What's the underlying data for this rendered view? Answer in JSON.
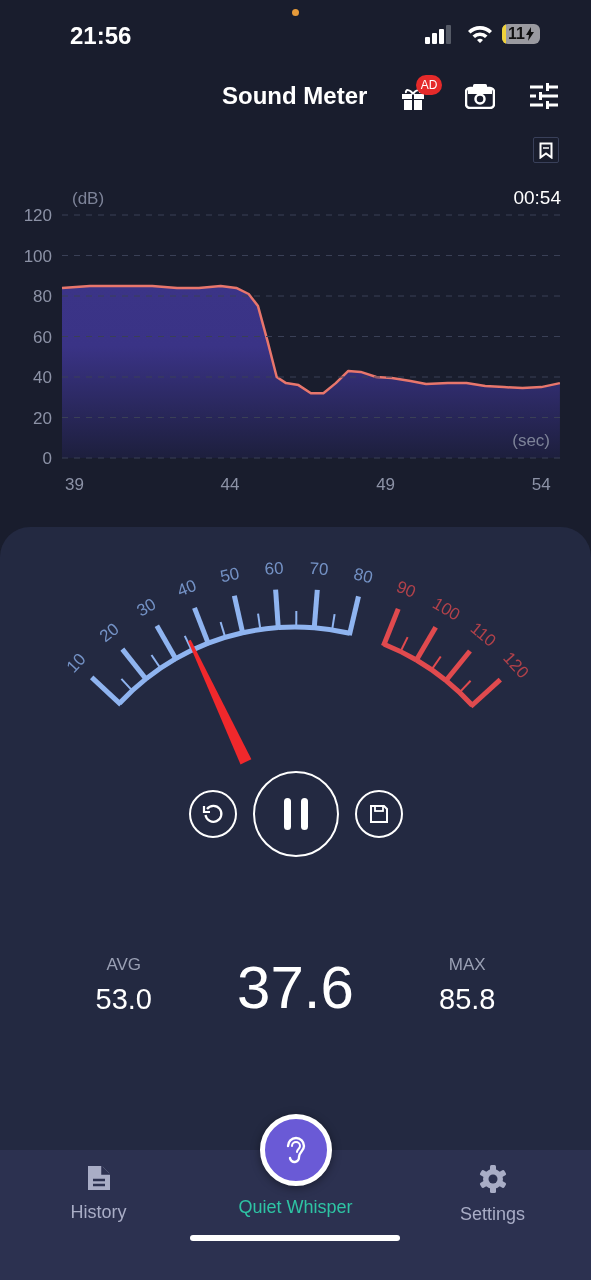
{
  "status_bar": {
    "time": "21:56",
    "battery": "11"
  },
  "header": {
    "title": "Sound Meter",
    "badge": "AD"
  },
  "chart": {
    "elapsed": "00:54",
    "chart_data": {
      "type": "area",
      "ylabel": "(dB)",
      "xlabel": "(sec)",
      "xlim": [
        38.6,
        54.7
      ],
      "ylim": [
        0,
        120
      ],
      "xticks": [
        39,
        44,
        49,
        54
      ],
      "yticks": [
        0,
        20,
        40,
        60,
        80,
        100,
        120
      ],
      "x": [
        38.6,
        39.5,
        40.5,
        41.5,
        42.3,
        43,
        43.7,
        44.2,
        44.6,
        44.9,
        45.2,
        45.5,
        45.8,
        46.2,
        46.6,
        47,
        47.4,
        47.8,
        48.2,
        48.7,
        49.2,
        49.8,
        50.3,
        51,
        51.6,
        52.2,
        52.8,
        53.4,
        54,
        54.6
      ],
      "grid": true,
      "series": [
        {
          "color": "#e8766c",
          "values": [
            84,
            85,
            85,
            85,
            84,
            84,
            85,
            84,
            81,
            75,
            58,
            40,
            37,
            36,
            32,
            32,
            37,
            43,
            42.5,
            40,
            39.5,
            38,
            36.5,
            37,
            37,
            35.5,
            35,
            34.5,
            35,
            37
          ]
        }
      ]
    }
  },
  "meter": {
    "scale": [
      {
        "label": "10",
        "color": "#8fb4f0"
      },
      {
        "label": "20",
        "color": "#8fb4f0"
      },
      {
        "label": "30",
        "color": "#8fb4f0"
      },
      {
        "label": "40",
        "color": "#8fb4f0"
      },
      {
        "label": "50",
        "color": "#8fb4f0"
      },
      {
        "label": "60",
        "color": "#8fb4f0"
      },
      {
        "label": "70",
        "color": "#8fb4f0"
      },
      {
        "label": "80",
        "color": "#8fb4f0"
      },
      {
        "label": "90",
        "color": "#e04a4e"
      },
      {
        "label": "100",
        "color": "#e04a4e"
      },
      {
        "label": "110",
        "color": "#e04a4e"
      },
      {
        "label": "120",
        "color": "#e04a4e"
      }
    ],
    "avg_label": "AVG",
    "avg": "53.0",
    "current": "37.6",
    "max_label": "MAX",
    "max": "85.8"
  },
  "tabs": [
    {
      "kind": "history",
      "label": "History",
      "selected": false
    },
    {
      "kind": "listen",
      "label": "Quiet Whisper",
      "selected": true
    },
    {
      "kind": "settings",
      "label": "Settings",
      "selected": false
    }
  ]
}
